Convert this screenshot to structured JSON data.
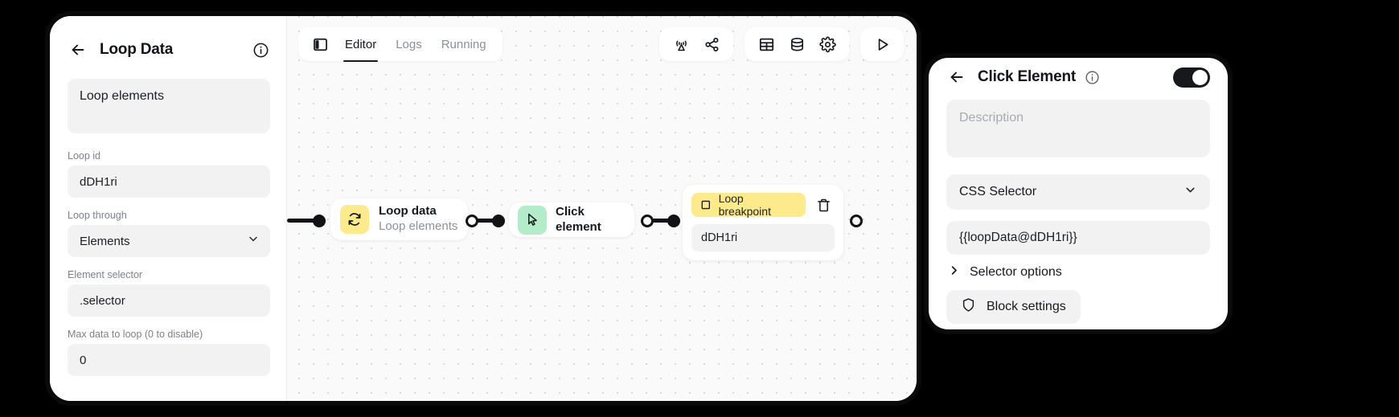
{
  "left_panel": {
    "title": "Loop Data",
    "back_icon": "arrow-left-icon",
    "info_icon": "info-circle-icon",
    "description_value": "Loop elements",
    "fields": [
      {
        "label": "Loop id",
        "value": "dDH1ri",
        "name": "loop-id"
      },
      {
        "label": "Loop through",
        "value": "Elements",
        "name": "loop-through",
        "type": "select"
      },
      {
        "label": "Element selector",
        "value": ".selector",
        "name": "element-selector"
      },
      {
        "label": "Max data to loop (0 to disable)",
        "value": "0",
        "name": "max-data-to-loop"
      }
    ]
  },
  "toolbar": {
    "panel_toggle_icon": "sidebar-panel-icon",
    "tabs": [
      {
        "label": "Editor",
        "active": true
      },
      {
        "label": "Logs",
        "active": false
      },
      {
        "label": "Running",
        "active": false
      }
    ],
    "group_two": [
      {
        "icon": "broadcast-icon",
        "name": "broadcast-button"
      },
      {
        "icon": "share-icon",
        "name": "share-button"
      }
    ],
    "group_three": [
      {
        "icon": "table-icon",
        "name": "table-button"
      },
      {
        "icon": "database-icon",
        "name": "database-button"
      },
      {
        "icon": "gear-icon",
        "name": "settings-button"
      }
    ],
    "run_icon": "play-icon"
  },
  "flow": {
    "nodes": [
      {
        "title": "Loop data",
        "subtitle": "Loop elements",
        "icon": "loop-refresh-icon",
        "color": "#fdeb8b"
      },
      {
        "title": "Click element",
        "subtitle": "",
        "icon": "cursor-pointer-icon",
        "color": "#b2ecc8"
      }
    ],
    "breakpoint": {
      "label": "Loop breakpoint",
      "checkbox_icon": "square-checkbox-icon",
      "delete_icon": "trash-icon",
      "value": "dDH1ri"
    }
  },
  "right_panel": {
    "title": "Click Element",
    "back_icon": "arrow-left-icon",
    "info_icon": "info-circle-icon",
    "toggle_on": true,
    "description_placeholder": "Description",
    "description_value": "",
    "selector_type": "CSS Selector",
    "selector_value": "{{loopData@dDH1ri}}",
    "selector_options_label": "Selector options",
    "block_settings_label": "Block settings",
    "chevron_icon": "chevron-down-icon",
    "disclosure_icon": "chevron-right-icon",
    "shield_icon": "shield-icon"
  }
}
